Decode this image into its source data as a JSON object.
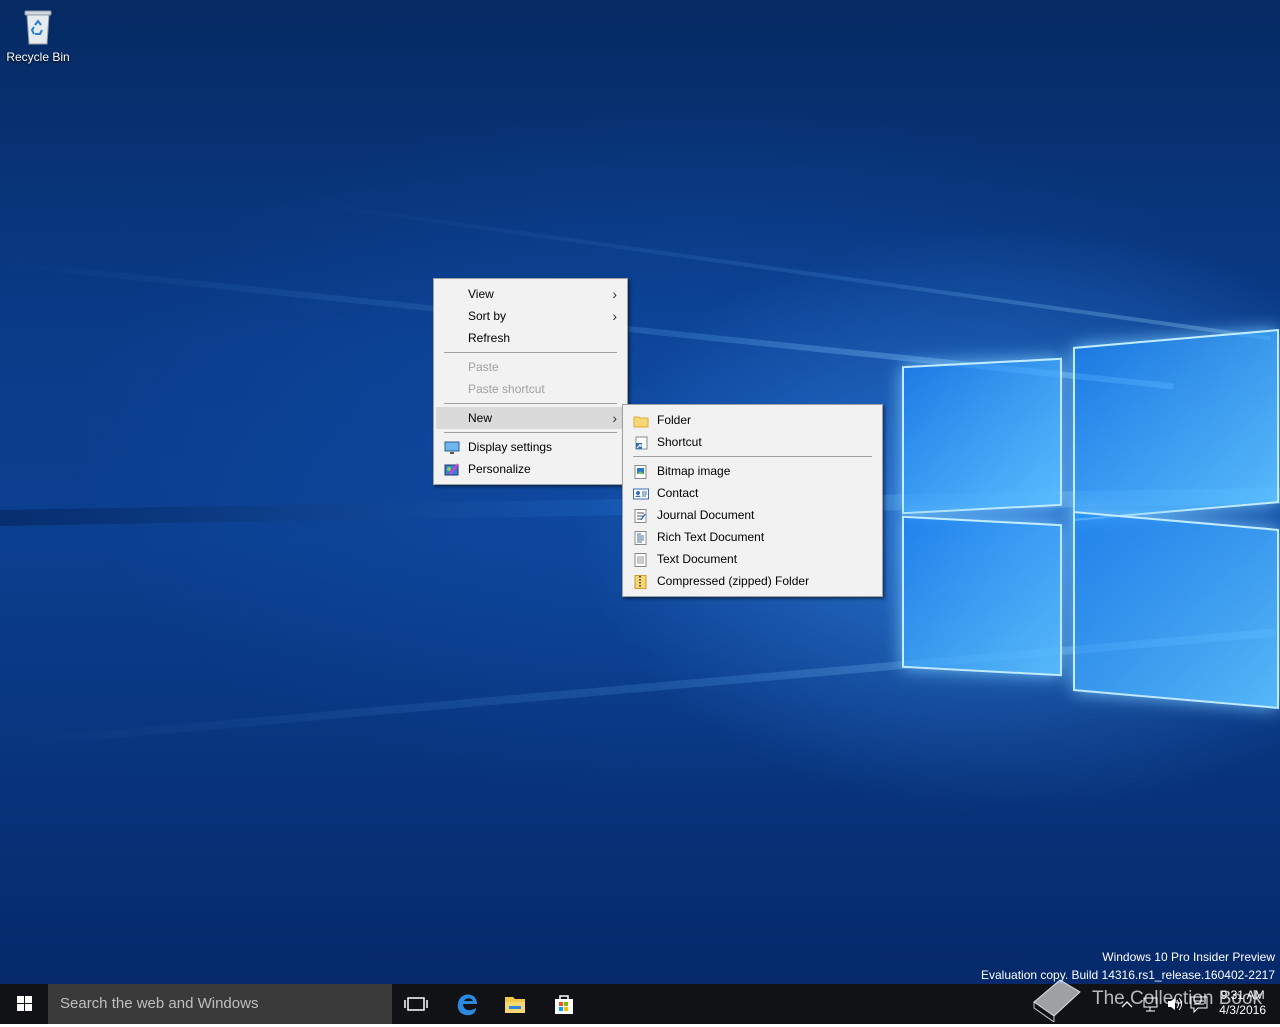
{
  "desktop": {
    "recycle_bin_label": "Recycle Bin",
    "watermark_line1": "Windows 10 Pro Insider Preview",
    "watermark_line2": "Evaluation copy. Build 14316.rs1_release.160402-2217"
  },
  "context_menu": {
    "items": [
      {
        "label": "View",
        "submenu": true,
        "enabled": true
      },
      {
        "label": "Sort by",
        "submenu": true,
        "enabled": true
      },
      {
        "label": "Refresh",
        "enabled": true
      },
      {
        "label": "Paste",
        "enabled": false
      },
      {
        "label": "Paste shortcut",
        "enabled": false
      },
      {
        "label": "New",
        "submenu": true,
        "enabled": true,
        "highlighted": true
      },
      {
        "label": "Display settings",
        "icon": "display-icon",
        "enabled": true
      },
      {
        "label": "Personalize",
        "icon": "personalize-icon",
        "enabled": true
      }
    ]
  },
  "new_submenu": {
    "items": [
      {
        "label": "Folder",
        "icon": "folder-icon"
      },
      {
        "label": "Shortcut",
        "icon": "shortcut-icon"
      },
      {
        "label": "Bitmap image",
        "icon": "bitmap-icon"
      },
      {
        "label": "Contact",
        "icon": "contact-icon"
      },
      {
        "label": "Journal Document",
        "icon": "journal-icon"
      },
      {
        "label": "Rich Text Document",
        "icon": "rich-text-icon"
      },
      {
        "label": "Text Document",
        "icon": "text-document-icon"
      },
      {
        "label": "Compressed (zipped) Folder",
        "icon": "zip-folder-icon"
      }
    ]
  },
  "taskbar": {
    "search_placeholder": "Search the web and Windows",
    "time": "9:31 AM",
    "date": "4/3/2016",
    "overlay_text": "The Collection Book"
  },
  "colors": {
    "menu_bg": "#f2f2f2",
    "menu_highlight": "#dadada",
    "taskbar_bg": "#101216",
    "search_bg": "#3a3a3a",
    "accent": "#0078d7"
  }
}
